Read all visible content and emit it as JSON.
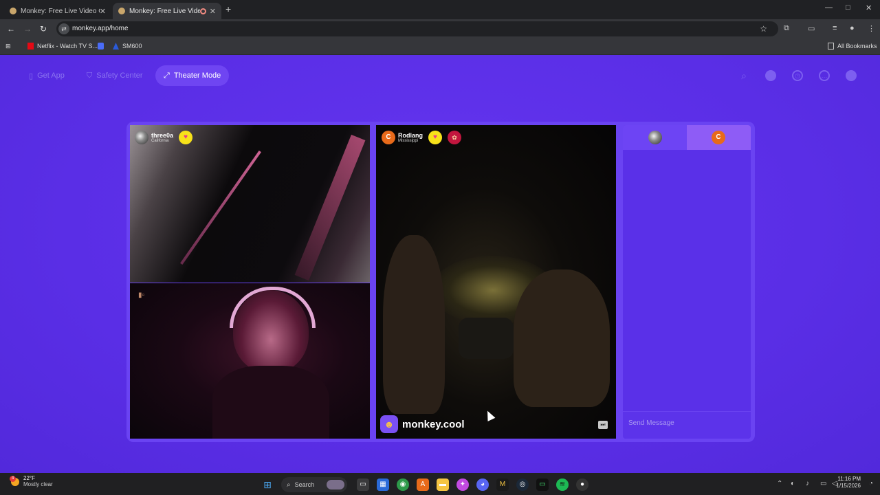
{
  "browser": {
    "tabs": [
      {
        "title": "Monkey: Free Live Video Chat"
      },
      {
        "title": "Monkey: Free Live Video Ch"
      }
    ],
    "url": "monkey.app/home",
    "bookmarks": [
      {
        "label": "Netflix - Watch TV S..."
      },
      {
        "label": ""
      },
      {
        "label": "SM600"
      }
    ],
    "all_bookmarks": "All Bookmarks"
  },
  "topnav": {
    "get_app": "Get App",
    "safety_center": "Safety Center",
    "theater_mode": "Theater Mode"
  },
  "videos": {
    "user1": {
      "name": "three0a",
      "location": "California"
    },
    "user2": {
      "name": "Rodlang",
      "location": "Mississippi",
      "avatar_letter": "C"
    },
    "brand": "monkey.cool"
  },
  "chat": {
    "header_avatar_letter": "C",
    "placeholder": "Send Message"
  },
  "taskbar": {
    "temperature": "22°F",
    "condition": "Mostly clear",
    "weather_badge": "4",
    "search_label": "Search",
    "time": "11:16 PM",
    "date": "1/15/2026"
  }
}
